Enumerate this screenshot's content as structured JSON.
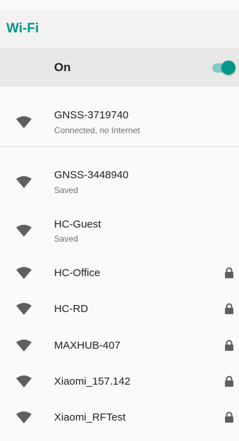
{
  "header": {
    "title": "Wi-Fi"
  },
  "master_switch": {
    "label": "On",
    "state": "on"
  },
  "colors": {
    "accent": "#009688",
    "accent_light": "#80cbc4"
  },
  "networks": [
    {
      "ssid": "GNSS-3719740",
      "status": "Connected, no Internet",
      "secured": false,
      "icon": "wifi-signal-icon"
    },
    {
      "ssid": "GNSS-3448940",
      "status": "Saved",
      "secured": false,
      "icon": "wifi-signal-icon"
    },
    {
      "ssid": "HC-Guest",
      "status": "Saved",
      "secured": false,
      "icon": "wifi-signal-icon"
    },
    {
      "ssid": "HC-Office",
      "status": "",
      "secured": true,
      "icon": "wifi-signal-icon"
    },
    {
      "ssid": "HC-RD",
      "status": "",
      "secured": true,
      "icon": "wifi-signal-icon"
    },
    {
      "ssid": "MAXHUB-407",
      "status": "",
      "secured": true,
      "icon": "wifi-signal-icon"
    },
    {
      "ssid": "Xiaomi_157.142",
      "status": "",
      "secured": true,
      "icon": "wifi-signal-icon"
    },
    {
      "ssid": "Xiaomi_RFTest",
      "status": "",
      "secured": true,
      "icon": "wifi-signal-icon"
    }
  ]
}
